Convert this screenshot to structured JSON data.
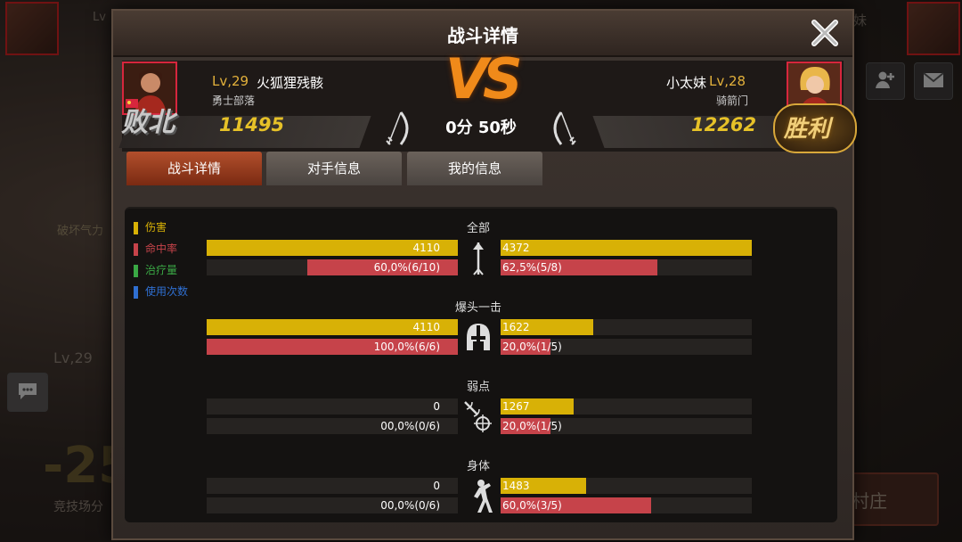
{
  "dialog": {
    "title": "战斗详情"
  },
  "players": {
    "left": {
      "level": "Lv,29",
      "name": "火狐狸残骸",
      "guild": "勇士部落",
      "score": "11495",
      "result": "败北"
    },
    "right": {
      "level": "Lv,28",
      "name": "小太妹",
      "guild": "骑箭门",
      "score": "12262",
      "result": "胜利"
    }
  },
  "vs_label": "VS",
  "timer": "0分 50秒",
  "tabs": [
    {
      "label": "战斗详情",
      "active": true
    },
    {
      "label": "对手信息",
      "active": false
    },
    {
      "label": "我的信息",
      "active": false
    }
  ],
  "legend": [
    {
      "label": "伤害",
      "color": "#d8b106"
    },
    {
      "label": "命中率",
      "color": "#c6434a"
    },
    {
      "label": "治疗量",
      "color": "#3aa845"
    },
    {
      "label": "使用次数",
      "color": "#2f6fd1"
    }
  ],
  "sections": [
    {
      "title": "全部",
      "icon": "arrow-icon",
      "left": {
        "damage": "4110",
        "damage_frac": 1.0,
        "hit": "60,0%(6/10)",
        "hit_frac": 0.6
      },
      "right": {
        "damage": "4372",
        "damage_frac": 1.0,
        "hit": "62,5%(5/8)",
        "hit_frac": 0.625
      }
    },
    {
      "title": "爆头一击",
      "icon": "helmet-icon",
      "left": {
        "damage": "4110",
        "damage_frac": 1.0,
        "hit": "100,0%(6/6)",
        "hit_frac": 1.0
      },
      "right": {
        "damage": "1622",
        "damage_frac": 0.37,
        "hit": "20,0%(1/5)",
        "hit_frac": 0.2
      }
    },
    {
      "title": "弱点",
      "icon": "weakpoint-target-icon",
      "left": {
        "damage": "0",
        "damage_frac": 0,
        "hit": "00,0%(0/6)",
        "hit_frac": 0
      },
      "right": {
        "damage": "1267",
        "damage_frac": 0.29,
        "hit": "20,0%(1/5)",
        "hit_frac": 0.2
      }
    },
    {
      "title": "身体",
      "icon": "body-figure-icon",
      "left": {
        "damage": "0",
        "damage_frac": 0,
        "hit": "00,0%(0/6)",
        "hit_frac": 0
      },
      "right": {
        "damage": "1483",
        "damage_frac": 0.34,
        "hit": "60,0%(3/5)",
        "hit_frac": 0.6
      }
    }
  ],
  "background": {
    "destroy_energy": "破坏气力",
    "level": "Lv,29",
    "big_number": "-25",
    "arena_label": "竞技场分",
    "village_button": "村庄",
    "bg_left_level": "Lv",
    "bg_right_name": "妹"
  }
}
